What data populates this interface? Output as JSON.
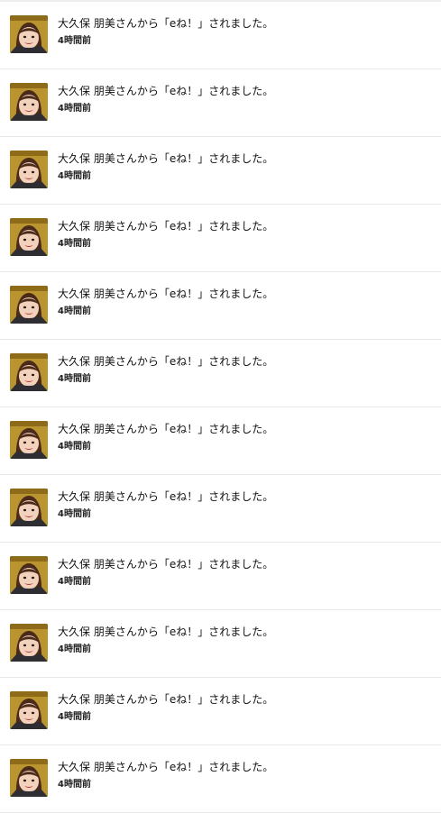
{
  "notifications": [
    {
      "message": "大久保 朋美さんから「eね！」されました。",
      "time": "4時間前"
    },
    {
      "message": "大久保 朋美さんから「eね！」されました。",
      "time": "4時間前"
    },
    {
      "message": "大久保 朋美さんから「eね！」されました。",
      "time": "4時間前"
    },
    {
      "message": "大久保 朋美さんから「eね！」されました。",
      "time": "4時間前"
    },
    {
      "message": "大久保 朋美さんから「eね！」されました。",
      "time": "4時間前"
    },
    {
      "message": "大久保 朋美さんから「eね！」されました。",
      "time": "4時間前"
    },
    {
      "message": "大久保 朋美さんから「eね！」されました。",
      "time": "4時間前"
    },
    {
      "message": "大久保 朋美さんから「eね！」されました。",
      "time": "4時間前"
    },
    {
      "message": "大久保 朋美さんから「eね！」されました。",
      "time": "4時間前"
    },
    {
      "message": "大久保 朋美さんから「eね！」されました。",
      "time": "4時間前"
    },
    {
      "message": "大久保 朋美さんから「eね！」されました。",
      "time": "4時間前"
    },
    {
      "message": "大久保 朋美さんから「eね！」されました。",
      "time": "4時間前"
    }
  ],
  "colors": {
    "avatar_background": "#b9942f",
    "divider": "#e8e8e8",
    "text": "#111111"
  }
}
